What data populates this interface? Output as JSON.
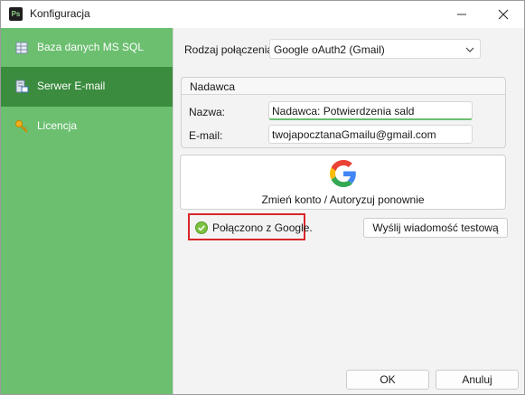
{
  "window": {
    "title": "Konfiguracja",
    "app_icon_text": "Ps"
  },
  "sidebar": {
    "items": [
      {
        "label": "Baza danych MS SQL",
        "icon": "database-icon"
      },
      {
        "label": "Serwer E-mail",
        "icon": "email-server-icon",
        "active": true
      },
      {
        "label": "Licencja",
        "icon": "key-icon"
      }
    ]
  },
  "connection": {
    "label": "Rodzaj połączenia",
    "selected": "Google oAuth2 (Gmail)"
  },
  "sender": {
    "title": "Nadawca",
    "name_label": "Nazwa:",
    "name_value": "Nadawca: Potwierdzenia sald",
    "email_label": "E-mail:",
    "email_value": "twojapocztanaGmailu@gmail.com"
  },
  "google": {
    "button_label": "Zmień konto / Autoryzuj ponownie",
    "status_text": "Połączono z Google."
  },
  "buttons": {
    "test": "Wyślij wiadomość testową",
    "ok": "OK",
    "cancel": "Anuluj"
  },
  "colors": {
    "sidebar": "#6bbf6f",
    "sidebar_active": "#3b8c3f",
    "highlight": "#d9262a"
  }
}
